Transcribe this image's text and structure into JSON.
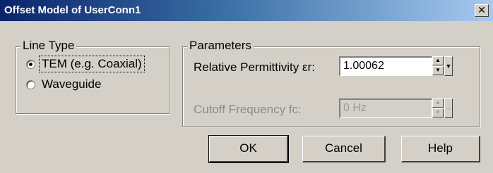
{
  "window": {
    "title": "Offset Model of UserConn1",
    "close_glyph": "✕"
  },
  "line_type": {
    "group_label": "Line Type",
    "options": [
      {
        "label": "TEM (e.g. Coaxial)",
        "selected": true
      },
      {
        "label": "Waveguide",
        "selected": false
      }
    ]
  },
  "parameters": {
    "group_label": "Parameters",
    "permittivity": {
      "label": "Relative Permittivity εr:",
      "value": "1.00062",
      "enabled": true
    },
    "cutoff": {
      "label": "Cutoff Frequency fc:",
      "value": "0 Hz",
      "enabled": false
    }
  },
  "buttons": {
    "ok": "OK",
    "cancel": "Cancel",
    "help": "Help"
  },
  "icons": {
    "spin_up": "▲",
    "spin_down": "▼",
    "dropdown": "▼",
    "dropdown_disabled": "–"
  },
  "colors": {
    "face": "#d4d0c8",
    "title_gradient_start": "#0a246a",
    "title_gradient_end": "#a6caf0",
    "disabled_text": "#8c8c8c"
  }
}
